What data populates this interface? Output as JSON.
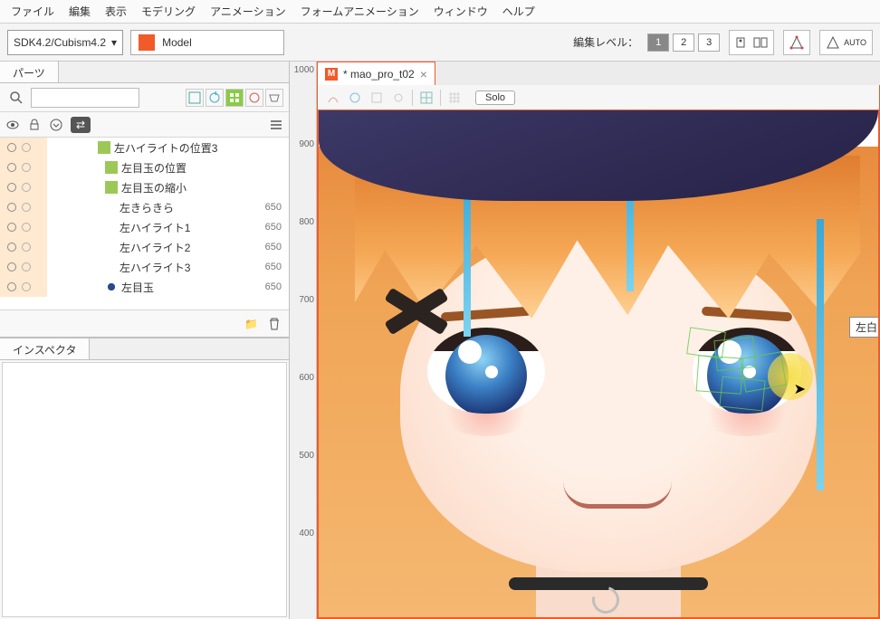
{
  "menu": {
    "file": "ファイル",
    "edit": "編集",
    "view": "表示",
    "modeling": "モデリング",
    "animation": "アニメーション",
    "formAnimation": "フォームアニメーション",
    "window": "ウィンドウ",
    "help": "ヘルプ"
  },
  "toolbar": {
    "sdk_label": "SDK4.2/Cubism4.2",
    "mode_label": "Model",
    "edit_level_label": "編集レベル：",
    "levels": [
      "1",
      "2",
      "3"
    ],
    "active_level": "1",
    "auto_label": "AUTO"
  },
  "parts_panel": {
    "tab": "パーツ",
    "search_placeholder": "",
    "items": [
      {
        "icon": "green",
        "label": "左ハイライトの位置3",
        "num": ""
      },
      {
        "icon": "green",
        "label": "左目玉の位置",
        "num": ""
      },
      {
        "icon": "green",
        "label": "左目玉の縮小",
        "num": ""
      },
      {
        "icon": "",
        "label": "左きらきら",
        "num": "650"
      },
      {
        "icon": "",
        "label": "左ハイライト1",
        "num": "650"
      },
      {
        "icon": "",
        "label": "左ハイライト2",
        "num": "650"
      },
      {
        "icon": "",
        "label": "左ハイライト3",
        "num": "650"
      },
      {
        "icon": "dot",
        "label": "左目玉",
        "num": "650"
      }
    ]
  },
  "inspector": {
    "tab": "インスペクタ"
  },
  "document": {
    "tab_title": "* mao_pro_t02"
  },
  "canvas": {
    "solo_label": "Solo",
    "ruler_ticks": [
      "1000",
      "900",
      "800",
      "700",
      "600",
      "500",
      "400"
    ],
    "tooltip": "左白目"
  }
}
